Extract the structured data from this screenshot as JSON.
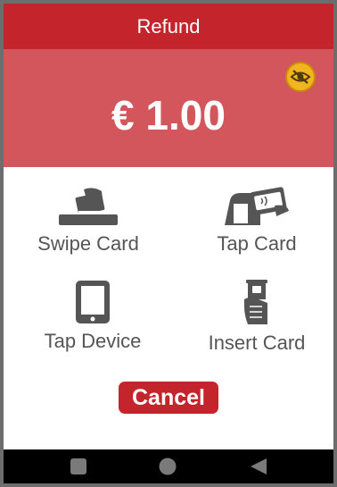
{
  "header": {
    "title": "Refund"
  },
  "amount": {
    "value": "€ 1.00",
    "privacy_icon": "eye-slash-icon"
  },
  "payment_options": [
    {
      "label": "Swipe Card",
      "icon": "swipe-card-icon"
    },
    {
      "label": "Tap Card",
      "icon": "tap-card-icon"
    },
    {
      "label": "Tap Device",
      "icon": "tap-device-icon"
    },
    {
      "label": "Insert Card",
      "icon": "insert-card-icon"
    }
  ],
  "actions": {
    "cancel_label": "Cancel"
  },
  "navbar": {
    "buttons": [
      "recents-icon",
      "home-icon",
      "back-icon"
    ]
  },
  "colors": {
    "header_red": "#c4252c",
    "amount_panel": "#d2565b",
    "icon_gray": "#555555",
    "privacy_yellow": "#f2b51f"
  }
}
